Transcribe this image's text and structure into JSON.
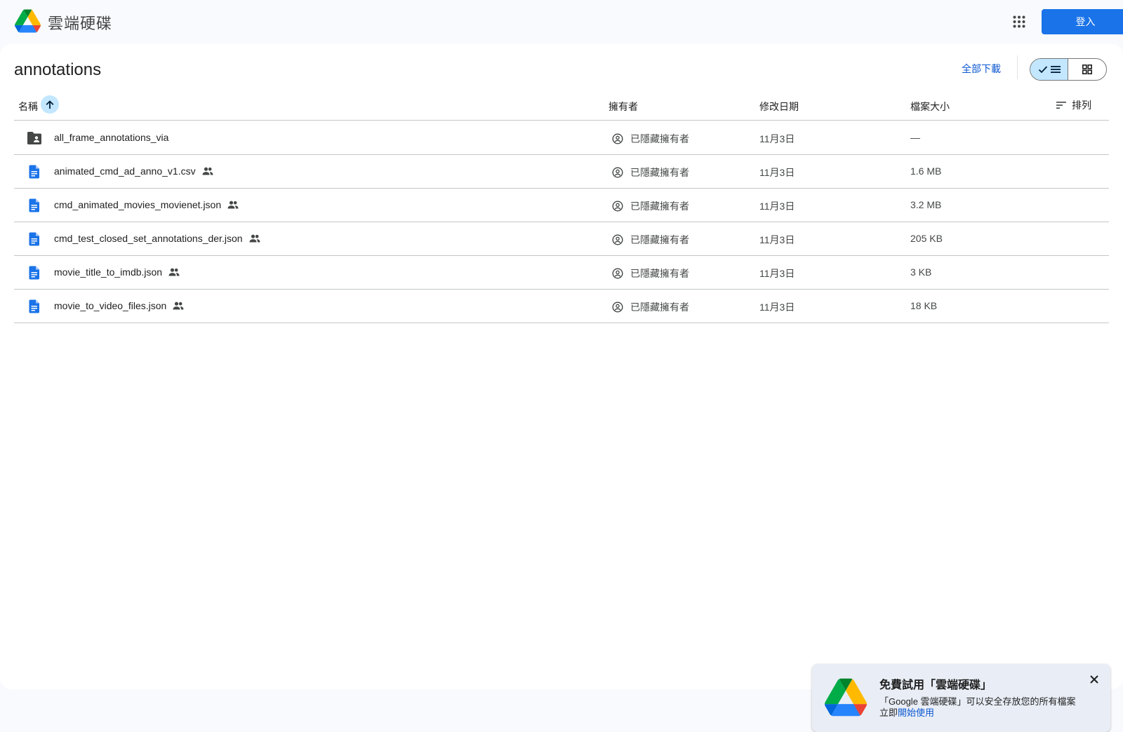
{
  "app": {
    "title": "雲端硬碟",
    "signin_label": "登入",
    "apps_icon": "apps-grid-icon"
  },
  "folder": {
    "title": "annotations",
    "download_all_label": "全部下載",
    "view_mode": "list"
  },
  "table": {
    "columns": {
      "name": "名稱",
      "owner": "擁有者",
      "modified": "修改日期",
      "size": "檔案大小",
      "sort": "排列"
    },
    "sort_direction": "ascending",
    "rows": [
      {
        "type": "folder",
        "name": "all_frame_annotations_via",
        "shared": false,
        "owner": "已隱藏擁有者",
        "modified": "11月3日",
        "size": "—"
      },
      {
        "type": "file",
        "name": "animated_cmd_ad_anno_v1.csv",
        "shared": true,
        "owner": "已隱藏擁有者",
        "modified": "11月3日",
        "size": "1.6 MB"
      },
      {
        "type": "file",
        "name": "cmd_animated_movies_movienet.json",
        "shared": true,
        "owner": "已隱藏擁有者",
        "modified": "11月3日",
        "size": "3.2 MB"
      },
      {
        "type": "file",
        "name": "cmd_test_closed_set_annotations_der.json",
        "shared": true,
        "owner": "已隱藏擁有者",
        "modified": "11月3日",
        "size": "205 KB"
      },
      {
        "type": "file",
        "name": "movie_title_to_imdb.json",
        "shared": true,
        "owner": "已隱藏擁有者",
        "modified": "11月3日",
        "size": "3 KB"
      },
      {
        "type": "file",
        "name": "movie_to_video_files.json",
        "shared": true,
        "owner": "已隱藏擁有者",
        "modified": "11月3日",
        "size": "18 KB"
      }
    ]
  },
  "promo": {
    "title": "免費試用「雲端硬碟」",
    "body": "「Google 雲端硬碟」可以安全存放您的所有檔案",
    "prefix": "立即",
    "link": "開始使用"
  },
  "colors": {
    "accent": "#1a73e8",
    "selected": "#c2e7ff",
    "file_icon": "#1a73e8",
    "folder_icon": "#444746"
  }
}
